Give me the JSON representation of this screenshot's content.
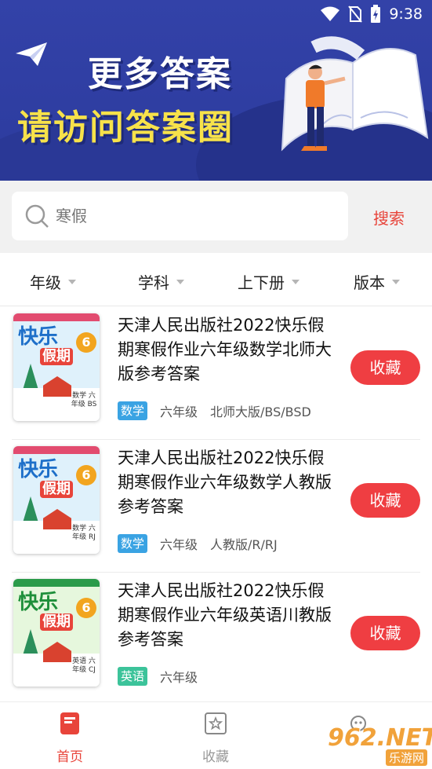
{
  "status_bar": {
    "time": "9:38",
    "icons": [
      "wifi-icon",
      "no-sim-icon",
      "battery-charging-icon"
    ]
  },
  "banner": {
    "line1": "更多答案",
    "line2": "请访问答案圈"
  },
  "search": {
    "placeholder": "寒假",
    "button_label": "搜索"
  },
  "filters": [
    {
      "label": "年级"
    },
    {
      "label": "学科"
    },
    {
      "label": "上下册"
    },
    {
      "label": "版本"
    }
  ],
  "items": [
    {
      "title": "天津人民出版社2022快乐假期寒假作业六年级数学北师大版参考答案",
      "subject_tag": "数学",
      "subject_color": "#3aa3e3",
      "grade": "六年级",
      "edition": "北师大版/BS/BSD",
      "fav_label": "收藏",
      "cover": {
        "title": "快乐",
        "subtitle": "假期",
        "num": "6",
        "label": "数学 六年级 BS"
      }
    },
    {
      "title": "天津人民出版社2022快乐假期寒假作业六年级数学人教版参考答案",
      "subject_tag": "数学",
      "subject_color": "#3aa3e3",
      "grade": "六年级",
      "edition": "人教版/R/RJ",
      "fav_label": "收藏",
      "cover": {
        "title": "快乐",
        "subtitle": "假期",
        "num": "6",
        "label": "数学 六年级 RJ"
      }
    },
    {
      "title": "天津人民出版社2022快乐假期寒假作业六年级英语川教版参考答案",
      "subject_tag": "英语",
      "subject_color": "#3cc39a",
      "grade": "六年级",
      "edition": "",
      "fav_label": "收藏",
      "cover": {
        "title": "快乐",
        "subtitle": "假期",
        "num": "6",
        "label": "英语 六年级 CJ"
      }
    }
  ],
  "bottom_nav": [
    {
      "label": "首页",
      "icon": "book-icon",
      "active": true,
      "color": "#e8443a"
    },
    {
      "label": "收藏",
      "icon": "star-box-icon",
      "active": false,
      "color": "#999999"
    }
  ],
  "watermark": {
    "big": "962.NET",
    "small": "乐游网"
  },
  "colors": {
    "accent": "#e8443a",
    "banner": "#3342a8",
    "banner_text_yellow": "#f7e24a"
  }
}
